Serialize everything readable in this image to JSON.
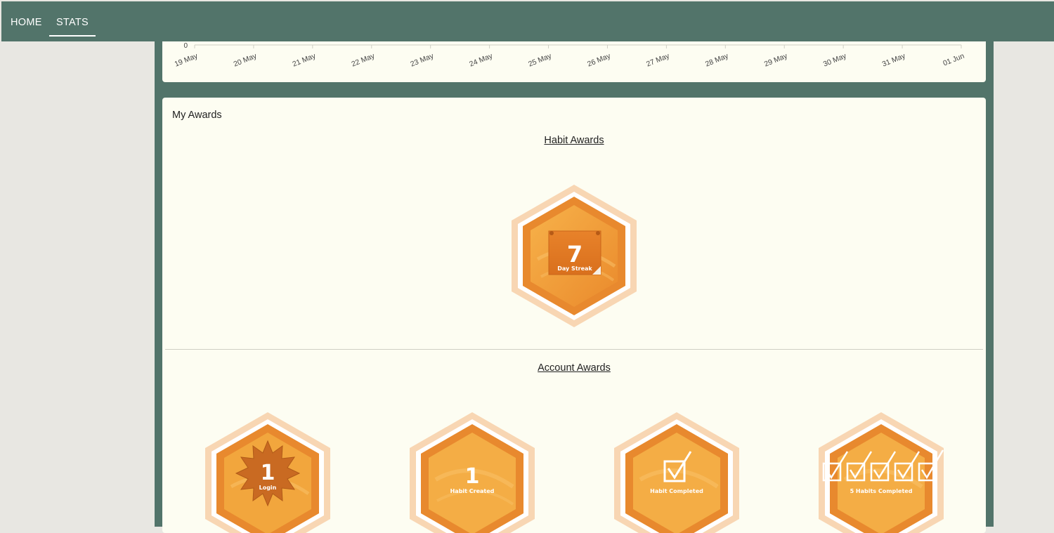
{
  "nav": {
    "home_label": "HOME",
    "stats_label": "STATS"
  },
  "chart_data": {
    "type": "line",
    "x": [
      "19 May",
      "20 May",
      "21 May",
      "22 May",
      "23 May",
      "24 May",
      "25 May",
      "26 May",
      "27 May",
      "28 May",
      "29 May",
      "30 May",
      "31 May",
      "01 Jun"
    ],
    "ylim": [
      0,
      null
    ],
    "y_ticks": [
      "0"
    ],
    "title": "",
    "xlabel": "",
    "ylabel": ""
  },
  "awards": {
    "title": "My Awards",
    "habit_heading": "Habit Awards",
    "account_heading": "Account Awards",
    "habit_badges": [
      {
        "number": "7",
        "caption": "Day Streak",
        "icon": "calendar-page-icon"
      }
    ],
    "account_badges": [
      {
        "number": "1",
        "caption": "Login",
        "icon": "starburst-icon"
      },
      {
        "number": "1",
        "caption": "Habit Created",
        "icon": "plain-icon"
      },
      {
        "number": "",
        "caption": "Habit Completed",
        "icon": "checkbox-icon"
      },
      {
        "number": "",
        "caption": "5 Habits Completed",
        "icon": "five-checkboxes-icon"
      }
    ]
  },
  "colors": {
    "navbar": "#52746a",
    "card_bg": "#fdfdf2",
    "page_bg": "#e8e7e2",
    "badge_orange": "#e8892e",
    "badge_light": "#f6cfa4"
  }
}
